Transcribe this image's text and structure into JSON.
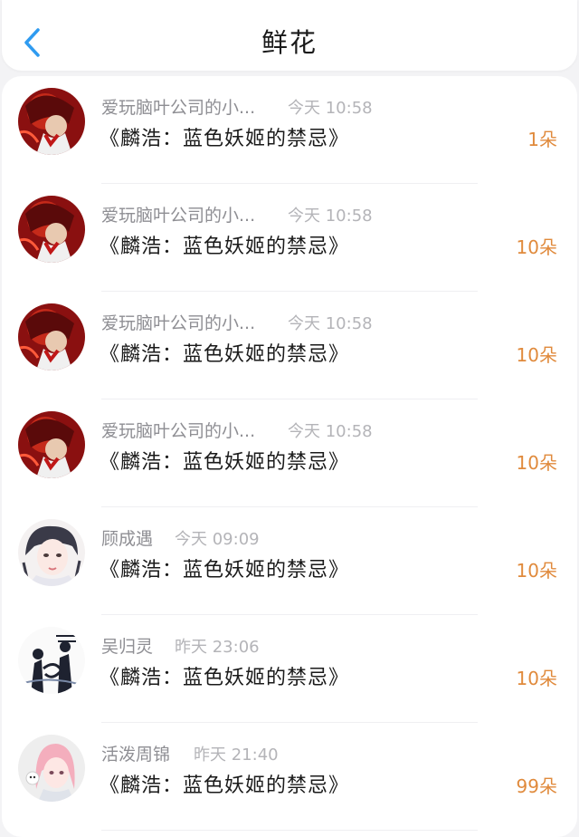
{
  "header": {
    "title": "鲜花",
    "back_icon": "chevron-left-icon",
    "accent": "#2f9bf0"
  },
  "count_color": "#e08a3c",
  "items": [
    {
      "name": "爱玩脑叶公司的小...",
      "time": "今天 10:58",
      "book": "《麟浩：蓝色妖姬的禁忌》",
      "count": "1朵",
      "avatar": "red-anime-avatar"
    },
    {
      "name": "爱玩脑叶公司的小...",
      "time": "今天 10:58",
      "book": "《麟浩：蓝色妖姬的禁忌》",
      "count": "10朵",
      "avatar": "red-anime-avatar"
    },
    {
      "name": "爱玩脑叶公司的小...",
      "time": "今天 10:58",
      "book": "《麟浩：蓝色妖姬的禁忌》",
      "count": "10朵",
      "avatar": "red-anime-avatar"
    },
    {
      "name": "爱玩脑叶公司的小...",
      "time": "今天 10:58",
      "book": "《麟浩：蓝色妖姬的禁忌》",
      "count": "10朵",
      "avatar": "red-anime-avatar"
    },
    {
      "name": "顾成遇",
      "time": "今天 09:09",
      "book": "《麟浩：蓝色妖姬的禁忌》",
      "count": "10朵",
      "avatar": "sketch-girl-avatar"
    },
    {
      "name": "吴归灵",
      "time": "昨天 23:06",
      "book": "《麟浩：蓝色妖姬的禁忌》",
      "count": "10朵",
      "avatar": "ink-figures-avatar"
    },
    {
      "name": "活泼周锦",
      "time": "昨天 21:40",
      "book": "《麟浩：蓝色妖姬的禁忌》",
      "count": "99朵",
      "avatar": "pink-hair-avatar"
    }
  ]
}
